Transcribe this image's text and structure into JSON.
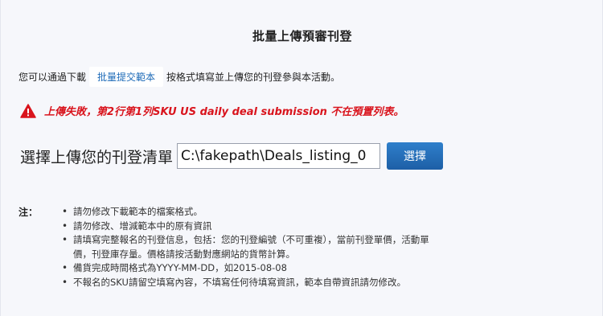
{
  "title": "批量上傳預審刊登",
  "intro": {
    "before": "您可以通過下載",
    "link": "批量提交範本",
    "after": "按格式填寫並上傳您的刊登參與本活動。"
  },
  "error": {
    "icon": "warning-icon",
    "color": "#d9141d",
    "message": "上傳失敗，第2行第1列SKU US daily deal submission 不在預置列表。"
  },
  "upload": {
    "label": "選擇上傳您的刊登清單",
    "file_value": "C:\\fakepath\\Deals_listing_0",
    "button": "選擇",
    "button_color": "#1d5fa6"
  },
  "notes": {
    "label": "注：",
    "items": [
      {
        "line1": "請勿修改下載範本的檔案格式。"
      },
      {
        "line1": "請勿修改、增減範本中的原有資訊"
      },
      {
        "line1": "請填寫完整報名的刊登信息，包括：您的刊登編號（不可重複），當前刊登單價，活動單",
        "line2": "價，刊登庫存量。價格請按活動對應網站的貨幣計算。"
      },
      {
        "line1": "備貨完成時間格式為YYYY-MM-DD，如2015-08-08"
      },
      {
        "line1": "不報名的SKU請留空填寫內容，不填寫任何待填寫資訊，範本自帶資訊請勿修改。"
      }
    ]
  }
}
